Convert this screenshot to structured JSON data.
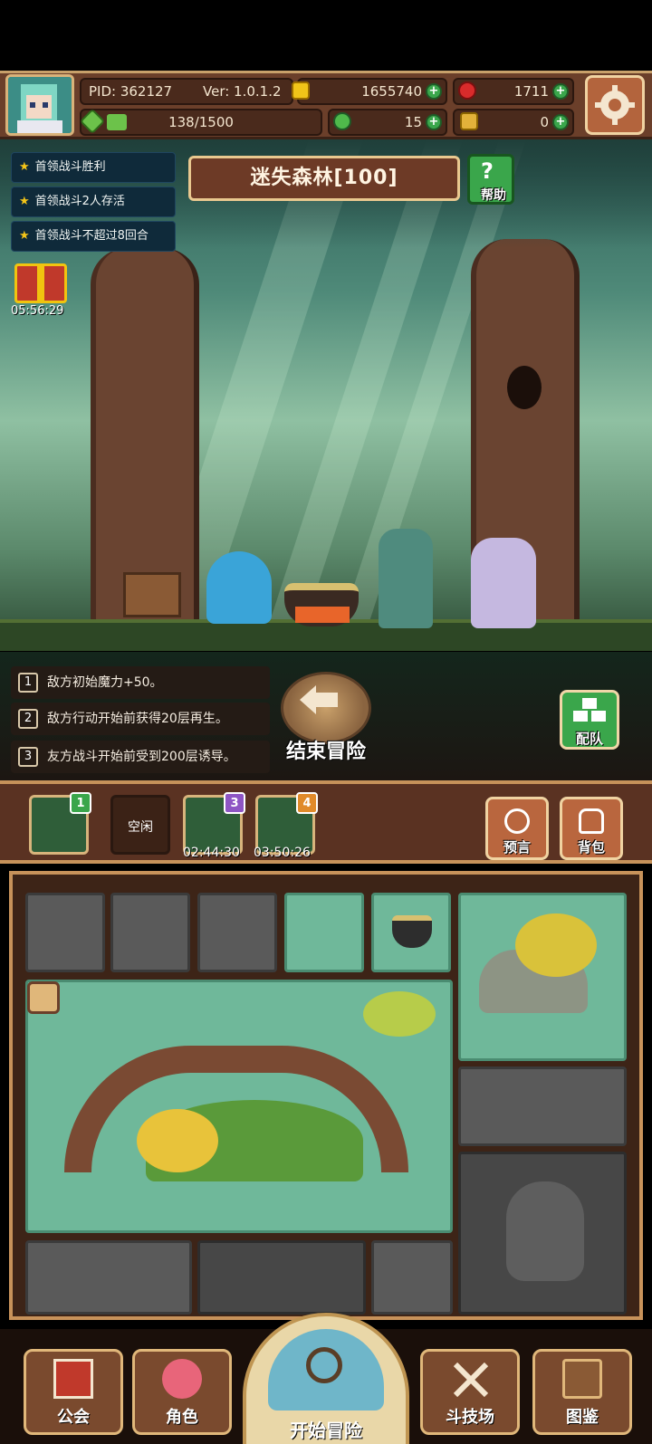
{
  "header": {
    "pid": "PID: 362127",
    "version": "Ver: 1.0.1.2",
    "gold": "1655740",
    "gems": "1711",
    "energy": "138/1500",
    "clover": "15",
    "key": "0",
    "energy_fraction": 0.092
  },
  "quests": [
    {
      "label": "首领战斗胜利"
    },
    {
      "label": "首领战斗2人存活"
    },
    {
      "label": "首领战斗不超过8回合"
    }
  ],
  "gift_timer": "05:56:29",
  "level": {
    "name": "迷失森林[100]",
    "help_label": "帮助"
  },
  "effects": [
    {
      "num": "1",
      "text": "敌方初始魔力+50。"
    },
    {
      "num": "2",
      "text": "敌方行动开始前获得20层再生。"
    },
    {
      "num": "3",
      "text": "友方战斗开始前受到200层诱导。"
    }
  ],
  "end_adventure_label": "结束冒险",
  "team_label": "配队",
  "slots": [
    {
      "badge": "1",
      "timer": ""
    },
    {
      "label": "空闲"
    },
    {
      "badge": "3",
      "timer": "02:44:30"
    },
    {
      "badge": "4",
      "timer": "03:50:26"
    }
  ],
  "side_buttons": {
    "prophecy": "预言",
    "backpack": "背包"
  },
  "nav": {
    "guild": "公会",
    "character": "角色",
    "start": "开始冒险",
    "arena": "斗技场",
    "codex": "图鉴"
  },
  "colors": {
    "accent": "#c7925a",
    "green": "#3aa64b",
    "panel": "#6b3f2a"
  }
}
